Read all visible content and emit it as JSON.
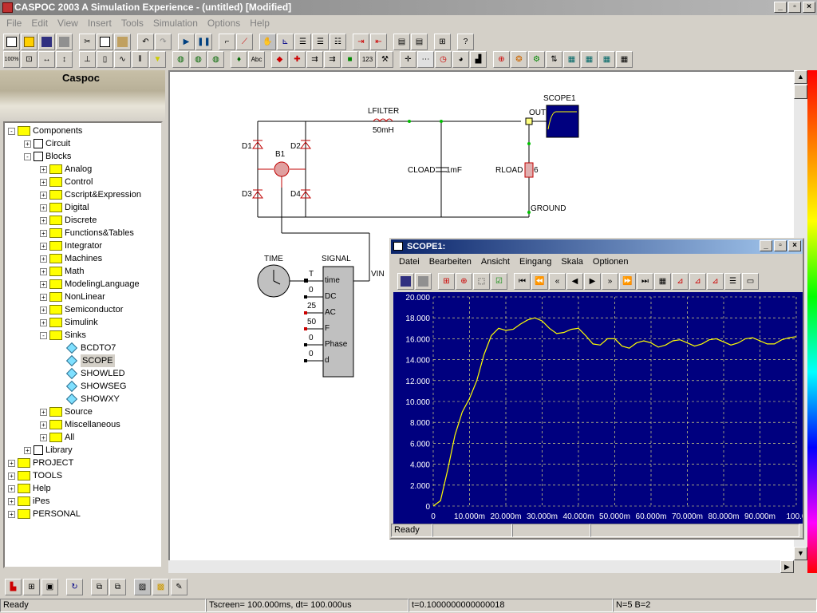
{
  "window": {
    "title": "CASPOC 2003 A Simulation Experience - (untitled) [Modified]"
  },
  "menu": [
    "File",
    "Edit",
    "View",
    "Insert",
    "Tools",
    "Simulation",
    "Options",
    "Help"
  ],
  "banner": {
    "logo": "Caspoc"
  },
  "tree": [
    {
      "label": "Components",
      "level": 0,
      "type": "folder",
      "pm": "-"
    },
    {
      "label": "Circuit",
      "level": 1,
      "type": "circuit",
      "pm": "+"
    },
    {
      "label": "Blocks",
      "level": 1,
      "type": "blocks",
      "pm": "-"
    },
    {
      "label": "Analog",
      "level": 2,
      "type": "folder",
      "pm": "+"
    },
    {
      "label": "Control",
      "level": 2,
      "type": "folder",
      "pm": "+"
    },
    {
      "label": "Cscript&Expression",
      "level": 2,
      "type": "folder",
      "pm": "+"
    },
    {
      "label": "Digital",
      "level": 2,
      "type": "folder",
      "pm": "+"
    },
    {
      "label": "Discrete",
      "level": 2,
      "type": "folder",
      "pm": "+"
    },
    {
      "label": "Functions&Tables",
      "level": 2,
      "type": "folder",
      "pm": "+"
    },
    {
      "label": "Integrator",
      "level": 2,
      "type": "folder",
      "pm": "+"
    },
    {
      "label": "Machines",
      "level": 2,
      "type": "folder",
      "pm": "+"
    },
    {
      "label": "Math",
      "level": 2,
      "type": "folder",
      "pm": "+"
    },
    {
      "label": "ModelingLanguage",
      "level": 2,
      "type": "folder",
      "pm": "+"
    },
    {
      "label": "NonLinear",
      "level": 2,
      "type": "folder",
      "pm": "+"
    },
    {
      "label": "Semiconductor",
      "level": 2,
      "type": "folder",
      "pm": "+"
    },
    {
      "label": "Simulink",
      "level": 2,
      "type": "folder",
      "pm": "+"
    },
    {
      "label": "Sinks",
      "level": 2,
      "type": "folder",
      "pm": "-"
    },
    {
      "label": "BCDTO7",
      "level": 3,
      "type": "item",
      "pm": ""
    },
    {
      "label": "SCOPE",
      "level": 3,
      "type": "item",
      "pm": "",
      "selected": true
    },
    {
      "label": "SHOWLED",
      "level": 3,
      "type": "item",
      "pm": ""
    },
    {
      "label": "SHOWSEG",
      "level": 3,
      "type": "item",
      "pm": ""
    },
    {
      "label": "SHOWXY",
      "level": 3,
      "type": "item",
      "pm": ""
    },
    {
      "label": "Source",
      "level": 2,
      "type": "folder",
      "pm": "+"
    },
    {
      "label": "Miscellaneous",
      "level": 2,
      "type": "folder",
      "pm": "+"
    },
    {
      "label": "All",
      "level": 2,
      "type": "folder",
      "pm": "+"
    },
    {
      "label": "Library",
      "level": 1,
      "type": "blocks",
      "pm": "+"
    },
    {
      "label": "PROJECT",
      "level": 0,
      "type": "folder",
      "pm": "+"
    },
    {
      "label": "TOOLS",
      "level": 0,
      "type": "folder",
      "pm": "+"
    },
    {
      "label": "Help",
      "level": 0,
      "type": "folder",
      "pm": "+"
    },
    {
      "label": "iPes",
      "level": 0,
      "type": "folder",
      "pm": "+"
    },
    {
      "label": "PERSONAL",
      "level": 0,
      "type": "folder",
      "pm": "+"
    }
  ],
  "circuit": {
    "lfilter": "LFILTER",
    "lfilter_value": "50mH",
    "scope": "SCOPE1",
    "out": "OUT",
    "d1": "D1",
    "d2": "D2",
    "d3": "D3",
    "d4": "D4",
    "b1": "B1",
    "cload": "CLOAD",
    "cload_value": "1mF",
    "rload": "RLOAD",
    "rload_value": "6",
    "ground": "GROUND",
    "time": "TIME",
    "signal": "SIGNAL",
    "vin": "VIN",
    "ports": [
      "time",
      "DC",
      "AC",
      "F",
      "Phase",
      "d"
    ],
    "port_values": [
      "T",
      "0",
      "25",
      "50",
      "0",
      "0"
    ]
  },
  "scope_window": {
    "title": "SCOPE1:",
    "menu": [
      "Datei",
      "Bearbeiten",
      "Ansicht",
      "Eingang",
      "Skala",
      "Optionen"
    ],
    "status": "Ready"
  },
  "chart_data": {
    "type": "line",
    "title": "",
    "xlabel": "",
    "ylabel": "",
    "xlim": [
      0,
      0.1
    ],
    "ylim": [
      0,
      20
    ],
    "yticks": [
      "20.000",
      "18.000",
      "16.000",
      "14.000",
      "12.000",
      "10.000",
      "8.000",
      "6.000",
      "4.000",
      "2.000",
      "0"
    ],
    "xticks": [
      "0",
      "10.000m",
      "20.000m",
      "30.000m",
      "40.000m",
      "50.000m",
      "60.000m",
      "70.000m",
      "80.000m",
      "90.000m",
      "100.0"
    ],
    "grid": true,
    "series": [
      {
        "color": "#ffff00",
        "x": [
          0,
          0.002,
          0.004,
          0.006,
          0.008,
          0.01,
          0.012,
          0.014,
          0.016,
          0.018,
          0.02,
          0.022,
          0.024,
          0.026,
          0.028,
          0.03,
          0.032,
          0.034,
          0.036,
          0.038,
          0.04,
          0.042,
          0.044,
          0.046,
          0.048,
          0.05,
          0.052,
          0.054,
          0.056,
          0.058,
          0.06,
          0.062,
          0.064,
          0.066,
          0.068,
          0.07,
          0.072,
          0.074,
          0.076,
          0.078,
          0.08,
          0.082,
          0.084,
          0.086,
          0.088,
          0.09,
          0.092,
          0.094,
          0.096,
          0.098,
          0.1
        ],
        "y": [
          0,
          0.5,
          3.5,
          6.8,
          9.0,
          10.3,
          12.0,
          14.5,
          16.3,
          17.0,
          16.8,
          16.9,
          17.4,
          17.8,
          18.0,
          17.7,
          17.0,
          16.5,
          16.6,
          16.9,
          17.0,
          16.3,
          15.5,
          15.4,
          16.0,
          16.0,
          15.3,
          15.1,
          15.6,
          15.8,
          15.6,
          15.2,
          15.4,
          15.8,
          15.9,
          15.6,
          15.3,
          15.5,
          15.9,
          16.0,
          15.7,
          15.4,
          15.6,
          16.0,
          16.1,
          15.8,
          15.5,
          15.5,
          15.9,
          16.1,
          16.2
        ]
      }
    ]
  },
  "statusbar": {
    "ready": "Ready",
    "tscreen": "Tscreen= 100.000ms, dt= 100.000us",
    "t": "t=0.1000000000000018",
    "nb": "N=5 B=2"
  }
}
